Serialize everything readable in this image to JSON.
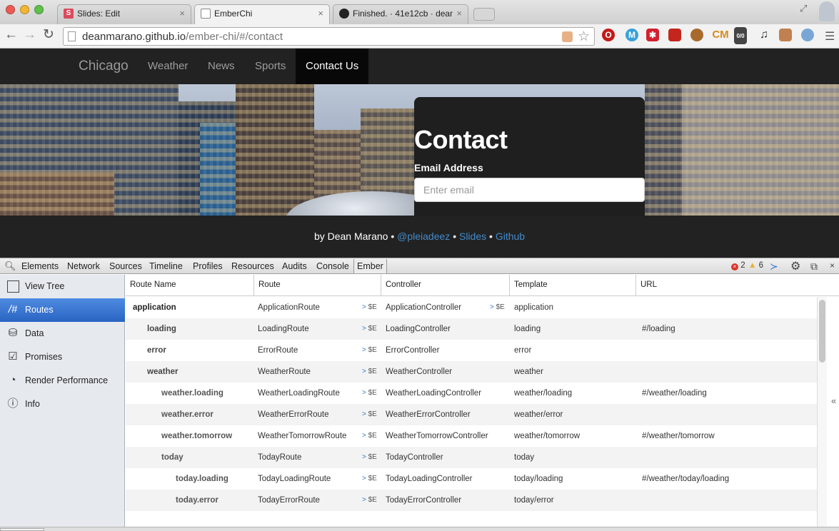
{
  "browser": {
    "tabs": [
      {
        "title": "Slides: Edit",
        "active": false,
        "favicon": "slides-icon",
        "color": "#d94b5e"
      },
      {
        "title": "EmberChi",
        "active": true,
        "favicon": "page-icon",
        "color": "#ffffff"
      },
      {
        "title": "Finished. · 41e12cb · dean",
        "active": false,
        "favicon": "github-icon",
        "color": "#222222"
      }
    ],
    "url": {
      "host": "deanmarano.github.io",
      "path": "/ember-chi/#/contact"
    },
    "extensions": [
      "opera-icon",
      "cloud-icon",
      "asterisk-icon",
      "sofa-icon",
      "ball-icon",
      "cm-icon",
      "counter-icon",
      "music-icon",
      "clapper-icon",
      "globe-icon"
    ],
    "extension_counter": "0/0",
    "extension_cm": "CM"
  },
  "site": {
    "brand": "Chicago",
    "nav": [
      "Weather",
      "News",
      "Sports",
      "Contact Us"
    ],
    "active_nav": "Contact Us",
    "contact_title": "Contact",
    "email_label": "Email Address",
    "email_placeholder": "Enter email",
    "footer": {
      "by": "by Dean Marano",
      "sep": "•",
      "links": [
        "@pleiadeez",
        "Slides",
        "Github"
      ]
    },
    "colors": {
      "navbar": "#222222",
      "link": "#428bca"
    }
  },
  "devtools": {
    "tabs": [
      "Elements",
      "Network",
      "Sources",
      "Timeline",
      "Profiles",
      "Resources",
      "Audits",
      "Console",
      "Ember"
    ],
    "active_tab": "Ember",
    "errors": "2",
    "warnings": "6",
    "sidebar": [
      {
        "label": "View Tree",
        "icon": "tree-icon"
      },
      {
        "label": "Routes",
        "icon": "hash-icon",
        "active": true
      },
      {
        "label": "Data",
        "icon": "database-icon"
      },
      {
        "label": "Promises",
        "icon": "check-icon"
      },
      {
        "label": "Render Performance",
        "icon": "gauge-icon"
      },
      {
        "label": "Info",
        "icon": "info-icon"
      }
    ],
    "columns": [
      "Route Name",
      "Route",
      "Controller",
      "Template",
      "URL"
    ],
    "send_label": "$E",
    "routes": [
      {
        "name": "application",
        "route": "ApplicationRoute",
        "controller": "ApplicationController",
        "template": "application",
        "url": "",
        "depth": 0
      },
      {
        "name": "loading",
        "route": "LoadingRoute",
        "controller": "LoadingController",
        "template": "loading",
        "url": "#/loading",
        "depth": 1
      },
      {
        "name": "error",
        "route": "ErrorRoute",
        "controller": "ErrorController",
        "template": "error",
        "url": "",
        "depth": 1
      },
      {
        "name": "weather",
        "route": "WeatherRoute",
        "controller": "WeatherController",
        "template": "weather",
        "url": "",
        "depth": 1
      },
      {
        "name": "weather.loading",
        "route": "WeatherLoadingRoute",
        "controller": "WeatherLoadingController",
        "template": "weather/loading",
        "url": "#/weather/loading",
        "depth": 2
      },
      {
        "name": "weather.error",
        "route": "WeatherErrorRoute",
        "controller": "WeatherErrorController",
        "template": "weather/error",
        "url": "",
        "depth": 2
      },
      {
        "name": "weather.tomorrow",
        "route": "WeatherTomorrowRoute",
        "controller": "WeatherTomorrowController",
        "template": "weather/tomorrow",
        "url": "#/weather/tomorrow",
        "depth": 2
      },
      {
        "name": "today",
        "route": "TodayRoute",
        "controller": "TodayController",
        "template": "today",
        "url": "",
        "depth": 2
      },
      {
        "name": "today.loading",
        "route": "TodayLoadingRoute",
        "controller": "TodayLoadingController",
        "template": "today/loading",
        "url": "#/weather/today/loading",
        "depth": 3
      },
      {
        "name": "today.error",
        "route": "TodayErrorRoute",
        "controller": "TodayErrorController",
        "template": "today/error",
        "url": "",
        "depth": 3
      }
    ]
  }
}
